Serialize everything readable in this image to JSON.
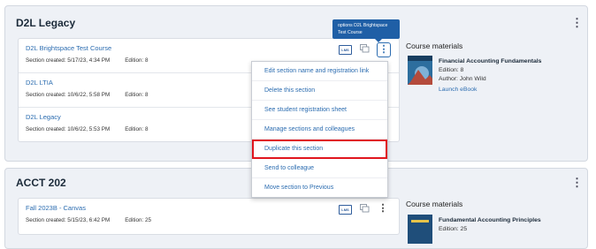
{
  "courses": [
    {
      "title": "D2L Legacy",
      "sections": [
        {
          "name": "D2L Brightspace Test Course",
          "created": "Section created: 5/17/23, 4:34 PM",
          "edition": "Edition: 8"
        },
        {
          "name": "D2L LTIA",
          "created": "Section created: 10/6/22, 5:58 PM",
          "edition": "Edition: 8"
        },
        {
          "name": "D2L Legacy",
          "created": "Section created: 10/6/22, 5:53 PM",
          "edition": "Edition: 8"
        }
      ],
      "materials": {
        "heading": "Course materials",
        "book_title": "Financial Accounting Fundamentals",
        "edition": "Edition: 8",
        "author": "Author: John Wild",
        "launch": "Launch eBook"
      }
    },
    {
      "title": "ACCT 202",
      "sections": [
        {
          "name": "Fall 2023B - Canvas",
          "created": "Section created: 5/15/23, 6:42 PM",
          "edition": "Edition: 25"
        }
      ],
      "materials": {
        "heading": "Course materials",
        "book_title": "Fundamental Accounting Principles",
        "edition": "Edition: 25"
      }
    }
  ],
  "lms_label": "LMS",
  "kebab_glyph": "⋮",
  "tooltip": "options D2L Brightspace Test Course",
  "menu": {
    "items": [
      "Edit section name and registration link",
      "Delete this section",
      "See student registration sheet",
      "Manage sections and colleagues",
      "Duplicate this section",
      "Send to colleague",
      "Move section to Previous"
    ],
    "highlighted_index": 4,
    "highlight_color": "#e0161e"
  },
  "colors": {
    "link": "#2b6cb0",
    "card_bg": "#eef1f6",
    "tooltip_bg": "#1f5fa6"
  }
}
